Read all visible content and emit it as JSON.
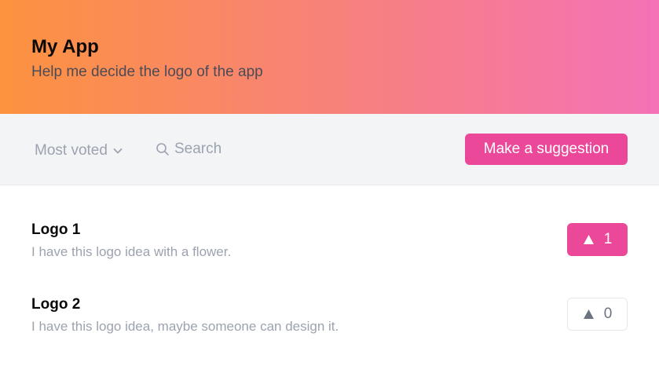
{
  "header": {
    "title": "My App",
    "subtitle": "Help me decide the logo of the app"
  },
  "toolbar": {
    "sort_label": "Most voted",
    "search_placeholder": "Search",
    "suggest_label": "Make a suggestion"
  },
  "suggestions": [
    {
      "title": "Logo 1",
      "description": "I have this logo idea with a flower.",
      "votes": "1",
      "voted": true
    },
    {
      "title": "Logo 2",
      "description": "I have this logo idea, maybe someone can design it.",
      "votes": "0",
      "voted": false
    }
  ],
  "colors": {
    "accent": "#ec4899",
    "header_gradient_start": "#fd923f",
    "header_gradient_end": "#f472b6",
    "toolbar_bg": "#f3f4f6"
  },
  "icons": {
    "sort": "chevron-down-icon",
    "search": "search-icon",
    "vote": "triangle-up-icon"
  }
}
